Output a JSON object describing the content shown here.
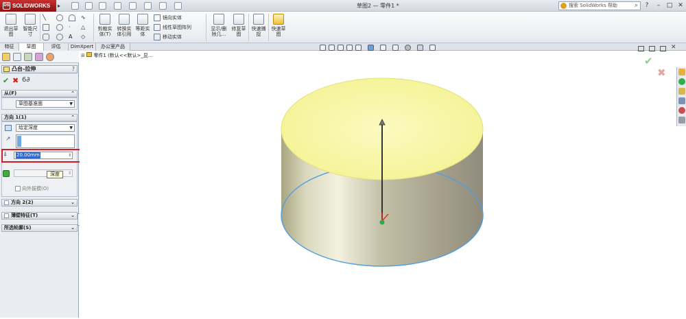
{
  "app": {
    "brand": "SOLIDWORKS",
    "window_title": "草图2 — 零件1 *"
  },
  "search": {
    "placeholder": "搜索 SolidWorks 帮助"
  },
  "ribbon": {
    "exit_sketch": "退出草图",
    "smart_dim": "智能尺寸",
    "cut_entities": "剪裁实体(T)",
    "convert_entities": "转换实体引用",
    "offset_entities": "等距实体",
    "mirror_entities": "镜向实体",
    "linear_pattern": "线性草图阵列",
    "move_entities": "移动实体",
    "display_relations": "显示/删除几...",
    "repair_sketch": "修复草图",
    "rapid_snap": "快速捕捉",
    "quick_sketch": "快速草图"
  },
  "tabs": [
    {
      "label": "特征",
      "active": false
    },
    {
      "label": "草图",
      "active": true
    },
    {
      "label": "评估",
      "active": false
    },
    {
      "label": "DimXpert",
      "active": false
    },
    {
      "label": "办公室产品",
      "active": false
    }
  ],
  "property_manager": {
    "title": "凸台-拉伸",
    "help": "?",
    "from": {
      "header": "从(F)",
      "value": "草图基准面"
    },
    "direction1": {
      "header": "方向 1(1)",
      "end_condition": "给定深度",
      "depth_value": "20.00mm",
      "draft_outward": "向外拔模(O)"
    },
    "direction2": {
      "header": "方向 2(2)"
    },
    "thin_feature": {
      "header": "薄壁特征(T)"
    },
    "contours": {
      "header": "所选轮廓(S)"
    }
  },
  "tooltip": {
    "text": "深度"
  },
  "tree": {
    "label": "零件1 (默认<<默认>_显..."
  },
  "colors": {
    "top_face": "#f7f5a2",
    "side_face": "#b9b59a",
    "edge": "#4f9fe0",
    "highlight": "#d51b22",
    "title_logo": "#b21f1f"
  }
}
